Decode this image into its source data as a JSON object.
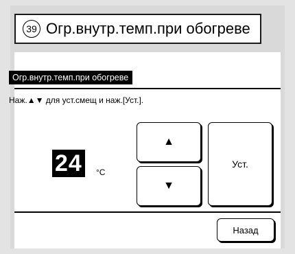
{
  "title": {
    "number": "39",
    "text": "Огр.внутр.темп.при обогреве"
  },
  "screen": {
    "header": "Огр.внутр.темп.при обогреве",
    "instruction": "Наж.▲▼ для уст.смещ и наж.[Уст.].",
    "temperature": {
      "value": "24",
      "unit": "°C"
    },
    "buttons": {
      "up_label": "▲",
      "down_label": "▼",
      "set_label": "Уст.",
      "back_label": "Назад"
    }
  }
}
